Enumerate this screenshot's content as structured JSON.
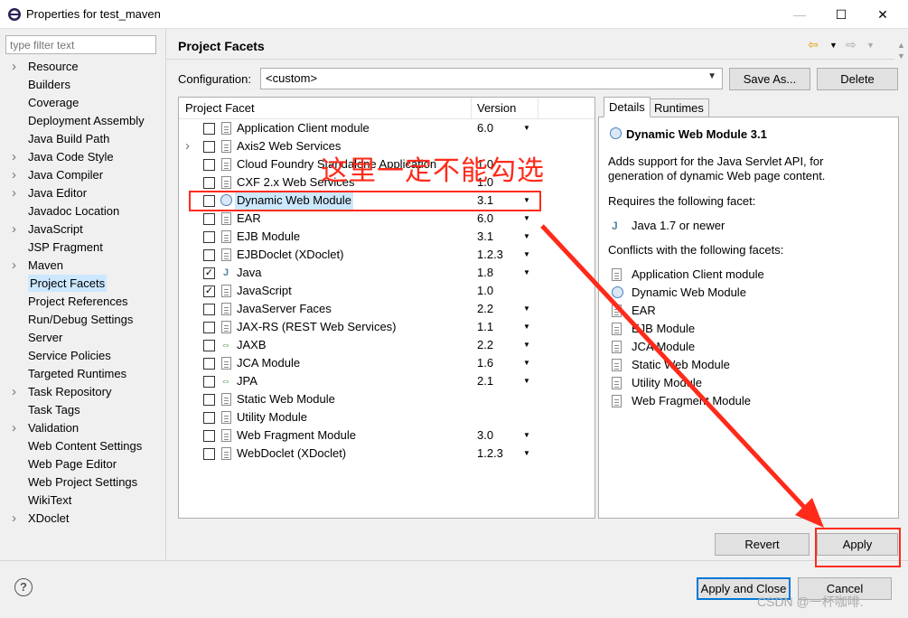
{
  "window": {
    "title": "Properties for test_maven",
    "min": "—",
    "max": "☐",
    "close": "✕"
  },
  "filter": {
    "placeholder": "type filter text"
  },
  "nav": [
    {
      "label": "Resource",
      "expandable": true
    },
    {
      "label": "Builders",
      "expandable": false
    },
    {
      "label": "Coverage",
      "expandable": false
    },
    {
      "label": "Deployment Assembly",
      "expandable": false
    },
    {
      "label": "Java Build Path",
      "expandable": false
    },
    {
      "label": "Java Code Style",
      "expandable": true
    },
    {
      "label": "Java Compiler",
      "expandable": true
    },
    {
      "label": "Java Editor",
      "expandable": true
    },
    {
      "label": "Javadoc Location",
      "expandable": false
    },
    {
      "label": "JavaScript",
      "expandable": true
    },
    {
      "label": "JSP Fragment",
      "expandable": false
    },
    {
      "label": "Maven",
      "expandable": true
    },
    {
      "label": "Project Facets",
      "expandable": false,
      "selected": true
    },
    {
      "label": "Project References",
      "expandable": false
    },
    {
      "label": "Run/Debug Settings",
      "expandable": false
    },
    {
      "label": "Server",
      "expandable": false
    },
    {
      "label": "Service Policies",
      "expandable": false
    },
    {
      "label": "Targeted Runtimes",
      "expandable": false
    },
    {
      "label": "Task Repository",
      "expandable": true
    },
    {
      "label": "Task Tags",
      "expandable": false
    },
    {
      "label": "Validation",
      "expandable": true
    },
    {
      "label": "Web Content Settings",
      "expandable": false
    },
    {
      "label": "Web Page Editor",
      "expandable": false
    },
    {
      "label": "Web Project Settings",
      "expandable": false
    },
    {
      "label": "WikiText",
      "expandable": false
    },
    {
      "label": "XDoclet",
      "expandable": true
    }
  ],
  "page": {
    "title": "Project Facets"
  },
  "config": {
    "label": "Configuration:",
    "value": "<custom>",
    "save_as": "Save As...",
    "delete": "Delete"
  },
  "facets": {
    "col_facet": "Project Facet",
    "col_version": "Version",
    "rows": [
      {
        "name": "Application Client module",
        "version": "6.0",
        "checked": false,
        "dd": true,
        "icon": "doc",
        "expand": false
      },
      {
        "name": "Axis2 Web Services",
        "version": "",
        "checked": false,
        "dd": false,
        "icon": "doc",
        "expand": true
      },
      {
        "name": "Cloud Foundry Standalone Application",
        "version": "1.0",
        "checked": false,
        "dd": false,
        "icon": "doc",
        "expand": false
      },
      {
        "name": "CXF 2.x Web Services",
        "version": "1.0",
        "checked": false,
        "dd": false,
        "icon": "doc",
        "expand": false
      },
      {
        "name": "Dynamic Web Module",
        "version": "3.1",
        "checked": false,
        "dd": true,
        "icon": "globe",
        "expand": false,
        "highlight": true
      },
      {
        "name": "EAR",
        "version": "6.0",
        "checked": false,
        "dd": true,
        "icon": "doc",
        "expand": false
      },
      {
        "name": "EJB Module",
        "version": "3.1",
        "checked": false,
        "dd": true,
        "icon": "doc",
        "expand": false
      },
      {
        "name": "EJBDoclet (XDoclet)",
        "version": "1.2.3",
        "checked": false,
        "dd": true,
        "icon": "doc",
        "expand": false
      },
      {
        "name": "Java",
        "version": "1.8",
        "checked": true,
        "dd": true,
        "icon": "java",
        "expand": false
      },
      {
        "name": "JavaScript",
        "version": "1.0",
        "checked": true,
        "dd": false,
        "icon": "doc",
        "expand": false
      },
      {
        "name": "JavaServer Faces",
        "version": "2.2",
        "checked": false,
        "dd": true,
        "icon": "doc",
        "expand": false
      },
      {
        "name": "JAX-RS (REST Web Services)",
        "version": "1.1",
        "checked": false,
        "dd": true,
        "icon": "doc",
        "expand": false
      },
      {
        "name": "JAXB",
        "version": "2.2",
        "checked": false,
        "dd": true,
        "icon": "arrows",
        "expand": false
      },
      {
        "name": "JCA Module",
        "version": "1.6",
        "checked": false,
        "dd": true,
        "icon": "doc",
        "expand": false
      },
      {
        "name": "JPA",
        "version": "2.1",
        "checked": false,
        "dd": true,
        "icon": "arrows",
        "expand": false
      },
      {
        "name": "Static Web Module",
        "version": "",
        "checked": false,
        "dd": false,
        "icon": "doc",
        "expand": false
      },
      {
        "name": "Utility Module",
        "version": "",
        "checked": false,
        "dd": false,
        "icon": "doc",
        "expand": false
      },
      {
        "name": "Web Fragment Module",
        "version": "3.0",
        "checked": false,
        "dd": true,
        "icon": "doc",
        "expand": false
      },
      {
        "name": "WebDoclet (XDoclet)",
        "version": "1.2.3",
        "checked": false,
        "dd": true,
        "icon": "doc",
        "expand": false
      }
    ]
  },
  "details": {
    "tab_details": "Details",
    "tab_runtimes": "Runtimes",
    "title": "Dynamic Web Module 3.1",
    "desc_line1": "Adds support for the Java Servlet API, for",
    "desc_line2": "generation of dynamic Web page content.",
    "requires_label": "Requires the following facet:",
    "requires": "Java 1.7 or newer",
    "conflicts_label": "Conflicts with the following facets:",
    "conflicts": [
      "Application Client module",
      "Dynamic Web Module",
      "EAR",
      "EJB Module",
      "JCA Module",
      "Static Web Module",
      "Utility Module",
      "Web Fragment Module"
    ]
  },
  "buttons": {
    "revert": "Revert",
    "apply": "Apply",
    "apply_close": "Apply and Close",
    "cancel": "Cancel",
    "help": "?"
  },
  "annotation": {
    "text": "这里一定不能勾选",
    "color": "#ff2a1a"
  },
  "watermark": "CSDN @一杯咖啡."
}
